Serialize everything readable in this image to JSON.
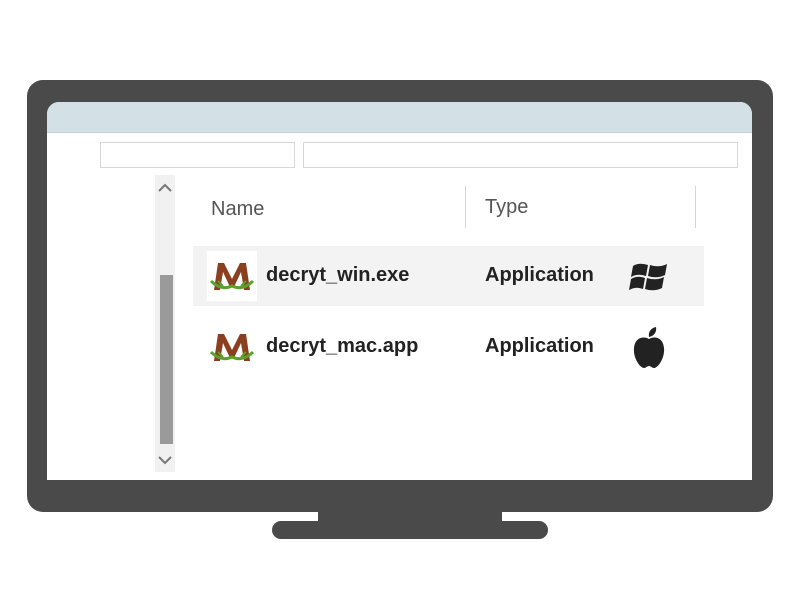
{
  "window": {
    "title": ""
  },
  "address_bar": {
    "location_value": "",
    "search_value": ""
  },
  "file_list": {
    "columns": [
      {
        "label": "Name"
      },
      {
        "label": "Type"
      }
    ],
    "rows": [
      {
        "name": "decryt_win.exe",
        "type": "Application",
        "app_icon": "malware-m-icon",
        "os_icon": "windows-logo-icon",
        "selected": true
      },
      {
        "name": "decryt_mac.app",
        "type": "Application",
        "app_icon": "malware-m-icon",
        "os_icon": "apple-logo-icon",
        "selected": false
      }
    ]
  },
  "colors": {
    "bezel": "#4a4a4a",
    "titlebar": "#d3e1e7",
    "selected_row": "#f3f3f3",
    "icon_brown": "#8b3f1f",
    "icon_green": "#5aa02c"
  }
}
